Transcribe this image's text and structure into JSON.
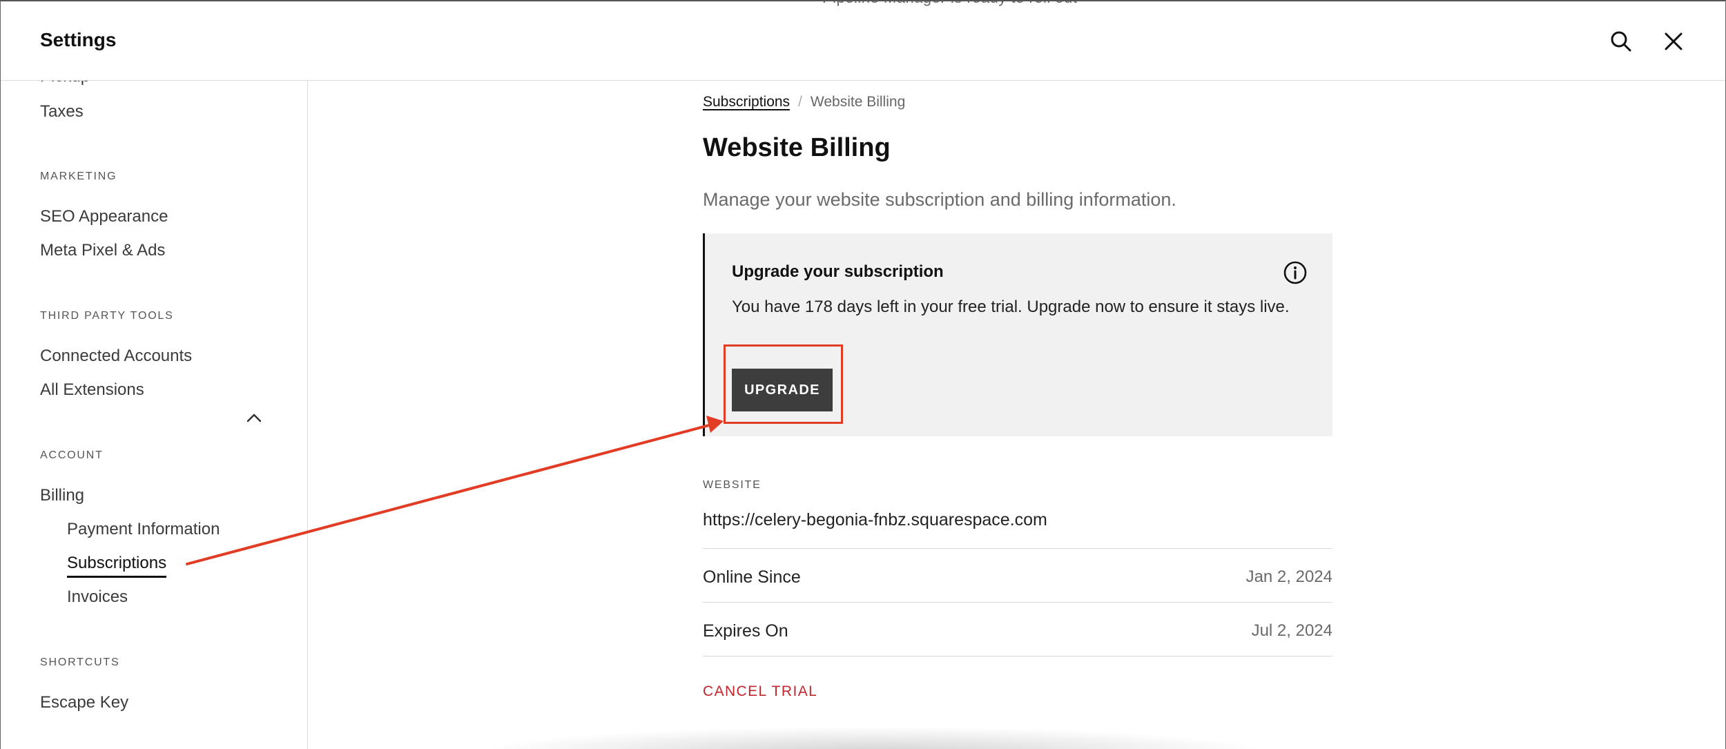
{
  "header": {
    "title": "Settings",
    "peek_text": "Pipeline Manager is ready to roll out"
  },
  "sidebar": {
    "partial_item": "Pickup",
    "items": [
      {
        "label": "Taxes"
      }
    ],
    "sections": [
      {
        "heading": "MARKETING",
        "items": [
          "SEO Appearance",
          "Meta Pixel & Ads"
        ]
      },
      {
        "heading": "THIRD PARTY TOOLS",
        "items": [
          "Connected Accounts",
          "All Extensions"
        ]
      },
      {
        "heading": "ACCOUNT",
        "parent": "Billing",
        "sub_items": [
          "Payment Information",
          "Subscriptions",
          "Invoices"
        ]
      },
      {
        "heading": "SHORTCUTS",
        "items": [
          "Escape Key"
        ]
      }
    ]
  },
  "main": {
    "breadcrumb": {
      "parent": "Subscriptions",
      "separator": "/",
      "current": "Website Billing"
    },
    "title": "Website Billing",
    "description": "Manage your website subscription and billing information.",
    "notice": {
      "title": "Upgrade your subscription",
      "body": "You have 178 days left in your free trial. Upgrade now to ensure it stays live.",
      "button": "UPGRADE"
    },
    "website_label": "WEBSITE",
    "website_url": "https://celery-begonia-fnbz.squarespace.com",
    "rows": [
      {
        "label": "Online Since",
        "value": "Jan 2, 2024"
      },
      {
        "label": "Expires On",
        "value": "Jul 2, 2024"
      }
    ],
    "cancel_label": "CANCEL TRIAL"
  },
  "colors": {
    "accent_red": "#c0262d",
    "annotation_red": "#e23c25",
    "button_dark": "#3d3d3d",
    "notice_bg": "#f1f1f1"
  },
  "icons": [
    "search-icon",
    "close-icon",
    "chevron-up-icon",
    "info-icon"
  ]
}
